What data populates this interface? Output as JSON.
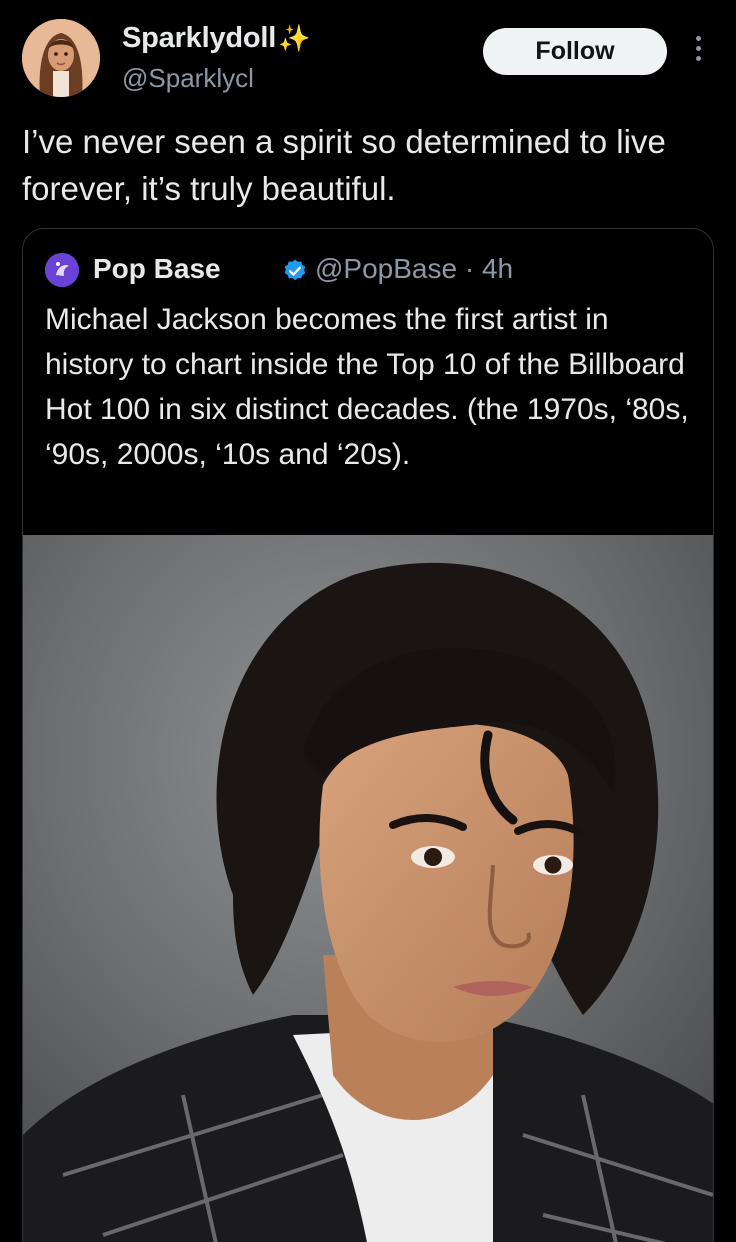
{
  "author": {
    "display_name": "Sparklydoll",
    "sparkle": "✨",
    "handle": "@Sparklycl",
    "avatar_icon": "doll-avatar"
  },
  "actions": {
    "follow_label": "Follow",
    "more_icon": "more-vertical-icon"
  },
  "tweet": {
    "text": "I’ve never seen a spirit so determined to live forever, it’s truly beautiful."
  },
  "quote": {
    "name": "Pop Base",
    "meta": "@PopBase · 4h",
    "verified_icon": "verified-badge-icon",
    "text": "Michael Jackson becomes the first artist in history to chart inside the Top 10 of the Billboard Hot 100 in six distinct decades. (the 1970s, ‘80s, ‘90s, 2000s, ‘10s and ‘20s).",
    "image": "portrait-photo"
  },
  "colors": {
    "background": "#000000",
    "text": "#e7e9ea",
    "secondary_text": "#8b98a5",
    "verified": "#1d9bf0",
    "border": "#2f3336"
  }
}
